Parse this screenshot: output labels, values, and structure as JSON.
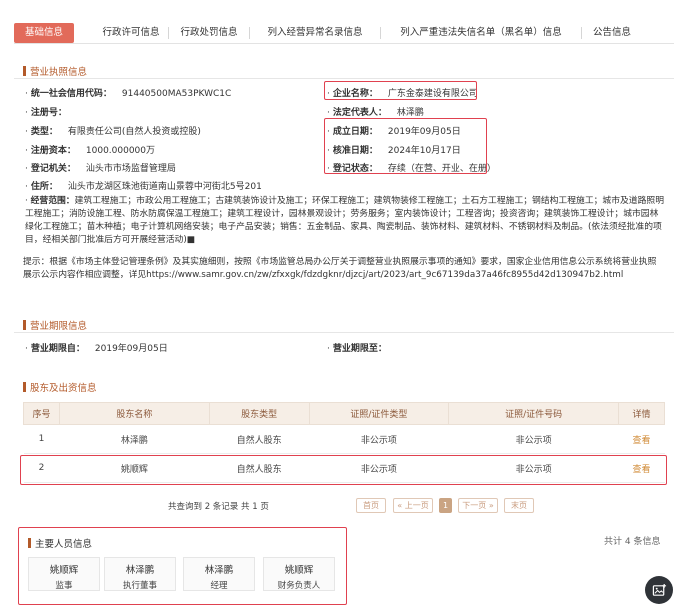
{
  "tabs": [
    {
      "label": "基础信息",
      "active": true
    },
    {
      "label": "行政许可信息"
    },
    {
      "label": "行政处罚信息"
    },
    {
      "label": "列入经营异常名录信息"
    },
    {
      "label": "列入严重违法失信名单（黑名单）信息"
    },
    {
      "label": "公告信息"
    }
  ],
  "license": {
    "title": "营业执照信息",
    "credit_code_label": "统一社会信用代码：",
    "credit_code": "91440500MA53PKWC1C",
    "company_name_label": "企业名称：",
    "company_name": "广东金泰建设有限公司",
    "reg_no_label": "注册号：",
    "reg_no": "",
    "legal_rep_label": "法定代表人：",
    "legal_rep": "林泽鹏",
    "type_label": "类型：",
    "type": "有限责任公司(自然人投资或控股)",
    "established_label": "成立日期：",
    "established": "2019年09月05日",
    "capital_label": "注册资本：",
    "capital": "1000.000000万",
    "approved_label": "核准日期：",
    "approved": "2024年10月17日",
    "authority_label": "登记机关：",
    "authority": "汕头市市场监督管理局",
    "status_label": "登记状态：",
    "status": "存续（在营、开业、在册）",
    "address_label": "住所：",
    "address": "汕头市龙湖区珠池街道南山景蓉中河街北5号201",
    "scope_label": "经营范围：",
    "scope": "建筑工程施工；市政公用工程施工；古建筑装饰设计及施工；环保工程施工；建筑物装修工程施工；土石方工程施工；钢结构工程施工；城市及道路照明工程施工；消防设施工程、防水防腐保温工程施工；建筑工程设计，园林景观设计；劳务服务；室内装饰设计；工程咨询；投资咨询；建筑装饰工程设计；城市园林绿化工程施工；苗木种植；电子计算机网络安装；电子产品安装；销售：五金制品、家具、陶瓷制品、装饰材料、建筑材料、不锈钢材料及制品。(依法须经批准的项目，经相关部门批准后方可开展经营活动)■",
    "notice": "提示：根据《市场主体登记管理条例》及其实施细则，按照《市场监管总局办公厅关于调整营业执照展示事项的通知》要求，国家企业信用信息公示系统将营业执照展示公示内容作相应调整，详见https://www.samr.gov.cn/zw/zfxxgk/fdzdgknr/djzcj/art/2023/art_9c67139da37a46fc8955d42d130947b2.html"
  },
  "term": {
    "title": "营业期限信息",
    "from_label": "营业期限自：",
    "from": "2019年09月05日",
    "to_label": "营业期限至：",
    "to": ""
  },
  "shareholders": {
    "title": "股东及出资信息",
    "headers": [
      "序号",
      "股东名称",
      "股东类型",
      "证照/证件类型",
      "证照/证件号码",
      "详情"
    ],
    "rows": [
      [
        "1",
        "林泽鹏",
        "自然人股东",
        "非公示项",
        "非公示项",
        "查看"
      ],
      [
        "2",
        "姚顺辉",
        "自然人股东",
        "非公示项",
        "非公示项",
        "查看"
      ]
    ],
    "pager_info": "共查询到 2 条记录 共 1 页",
    "first": "首页",
    "prev": "« 上一页",
    "current": "1",
    "next": "下一页 »",
    "last": "末页"
  },
  "staff": {
    "title": "主要人员信息",
    "total": "共计 4 条信息",
    "people": [
      {
        "name": "姚顺辉",
        "role": "监事"
      },
      {
        "name": "林泽鹏",
        "role": "执行董事"
      },
      {
        "name": "林泽鹏",
        "role": "经理"
      },
      {
        "name": "姚顺辉",
        "role": "财务负责人"
      }
    ]
  },
  "colors": {
    "accent": "#e26a5a",
    "highlight_border": "#e0414f",
    "section": "#b35a2a"
  },
  "icons": {
    "fab": "image-plus-icon"
  }
}
